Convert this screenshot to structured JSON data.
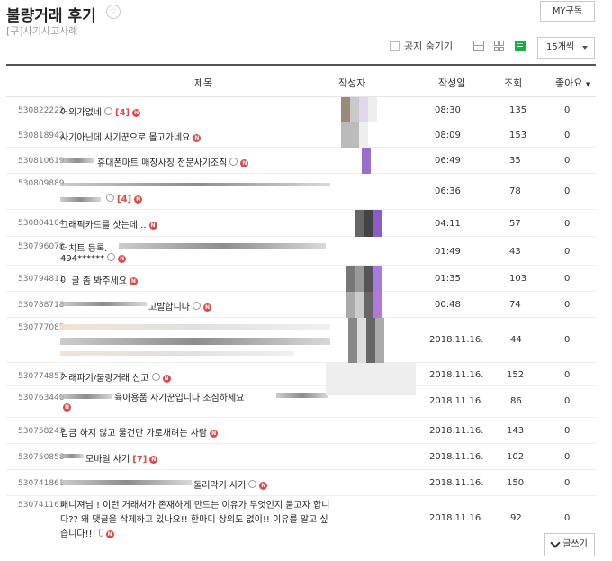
{
  "header": {
    "title": "불량거래 후기",
    "star": "☆",
    "subtitle": "[구]사기사고사례",
    "my_subscribe_label": "MY구독"
  },
  "toolbar": {
    "hide_notice_label": "공지 숨기기",
    "page_size_value": "15개씩"
  },
  "columns": {
    "title": "제목",
    "author": "작성자",
    "date": "작성일",
    "views": "조회",
    "likes": "좋아요"
  },
  "rows": [
    {
      "num": "530822222",
      "subject": "어의가없네",
      "comments": "[4]",
      "time": "08:30",
      "views": "135",
      "likes": "0"
    },
    {
      "num": "530818942",
      "subject": "사기아닌데 사기꾼으로 몰고가네요",
      "comments": "",
      "time": "08:09",
      "views": "153",
      "likes": "0"
    },
    {
      "num": "530810619",
      "subject": "휴대폰마트 매장사칭 전문사기조직",
      "comments": "",
      "time": "06:49",
      "views": "35",
      "likes": "0"
    },
    {
      "num": "530809889",
      "subject": "",
      "comments": "[4]",
      "time": "06:36",
      "views": "78",
      "likes": "0"
    },
    {
      "num": "530804104",
      "subject": "그래픽카드를 삿는데...",
      "comments": "",
      "time": "04:11",
      "views": "57",
      "likes": "0"
    },
    {
      "num": "530796078",
      "subject": "더치트 등록.",
      "subject2": "494******",
      "comments": "",
      "time": "01:49",
      "views": "43",
      "likes": "0"
    },
    {
      "num": "530794811",
      "subject": "이 글 좀 봐주세요",
      "comments": "",
      "time": "01:35",
      "views": "103",
      "likes": "0"
    },
    {
      "num": "530788718",
      "subject": "고발합니다",
      "comments": "",
      "time": "00:48",
      "views": "74",
      "likes": "0"
    },
    {
      "num": "530777085",
      "subject": "",
      "comments": "",
      "time": "2018.11.16.",
      "views": "44",
      "likes": "0"
    },
    {
      "num": "530774857",
      "subject": "거래파기/불량거래 신고",
      "comments": "",
      "time": "2018.11.16.",
      "views": "152",
      "likes": "0"
    },
    {
      "num": "530763446",
      "subject": "육아용품 사기꾼입니다 조심하세요",
      "comments": "",
      "time": "2018.11.16.",
      "views": "86",
      "likes": "0"
    },
    {
      "num": "530758243",
      "subject": "입금 하지 않고 물건만 가로채려는 사람",
      "comments": "",
      "time": "2018.11.16.",
      "views": "143",
      "likes": "0"
    },
    {
      "num": "530750858",
      "subject": "모바일 사기",
      "comments": "[7]",
      "time": "2018.11.16.",
      "views": "102",
      "likes": "0"
    },
    {
      "num": "530741861",
      "subject": "둘러막기 사기",
      "comments": "",
      "time": "2018.11.16.",
      "views": "150",
      "likes": "0"
    },
    {
      "num": "530741163",
      "subject": "매니져님 ! 이런 거래처가 존재하게 만드는 이유가 무엇인지 묻고자 합니다?? 왜 댓글을 삭제하고 있나요!! 한마디 상의도 없이!! 이유를 알고 싶습니다!!!",
      "comments": "",
      "time": "2018.11.16.",
      "views": "92",
      "likes": "0"
    }
  ],
  "write_label": "글쓰기",
  "badge_new": "N",
  "colors": {
    "accent_green": "#14b13f",
    "new_badge": "#e34848",
    "comment_count": "#e34848"
  }
}
